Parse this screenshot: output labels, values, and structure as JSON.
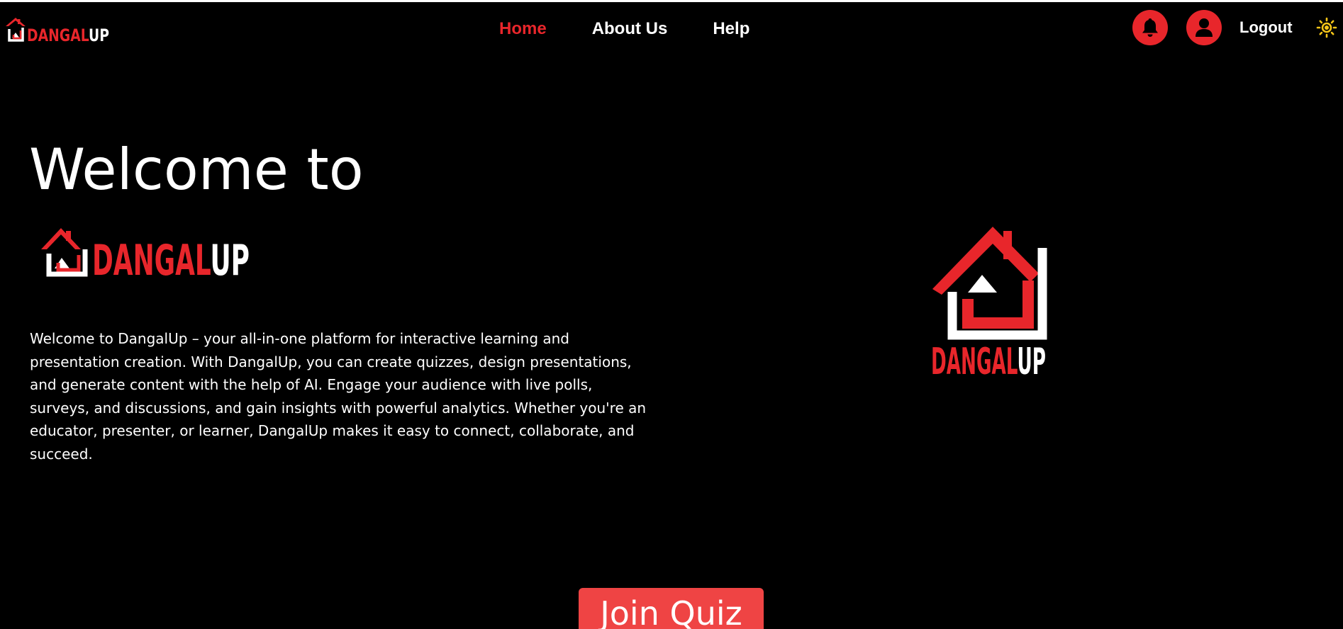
{
  "app": {
    "brand_name": "DANGALUP",
    "brand_part_red": "DANGAL",
    "brand_part_white": "UP"
  },
  "colors": {
    "accent": "#e8262b",
    "button": "#ef4444",
    "background": "#000000",
    "text": "#ffffff",
    "sun": "#f5c518"
  },
  "nav": {
    "links": [
      {
        "label": "Home",
        "active": true
      },
      {
        "label": "About Us",
        "active": false
      },
      {
        "label": "Help",
        "active": false
      }
    ],
    "notifications_icon": "bell-icon",
    "profile_icon": "user-icon",
    "logout_label": "Logout",
    "theme_icon": "sun-icon"
  },
  "hero": {
    "title": "Welcome to",
    "description": "Welcome to DangalUp – your all-in-one platform for interactive learning and presentation creation. With DangalUp, you can create quizzes, design presentations, and generate content with the help of AI. Engage your audience with live polls, surveys, and discussions, and gain insights with powerful analytics. Whether you're an educator, presenter, or learner, DangalUp makes it easy to connect, collaborate, and succeed.",
    "cta_label": "Join Quiz"
  }
}
